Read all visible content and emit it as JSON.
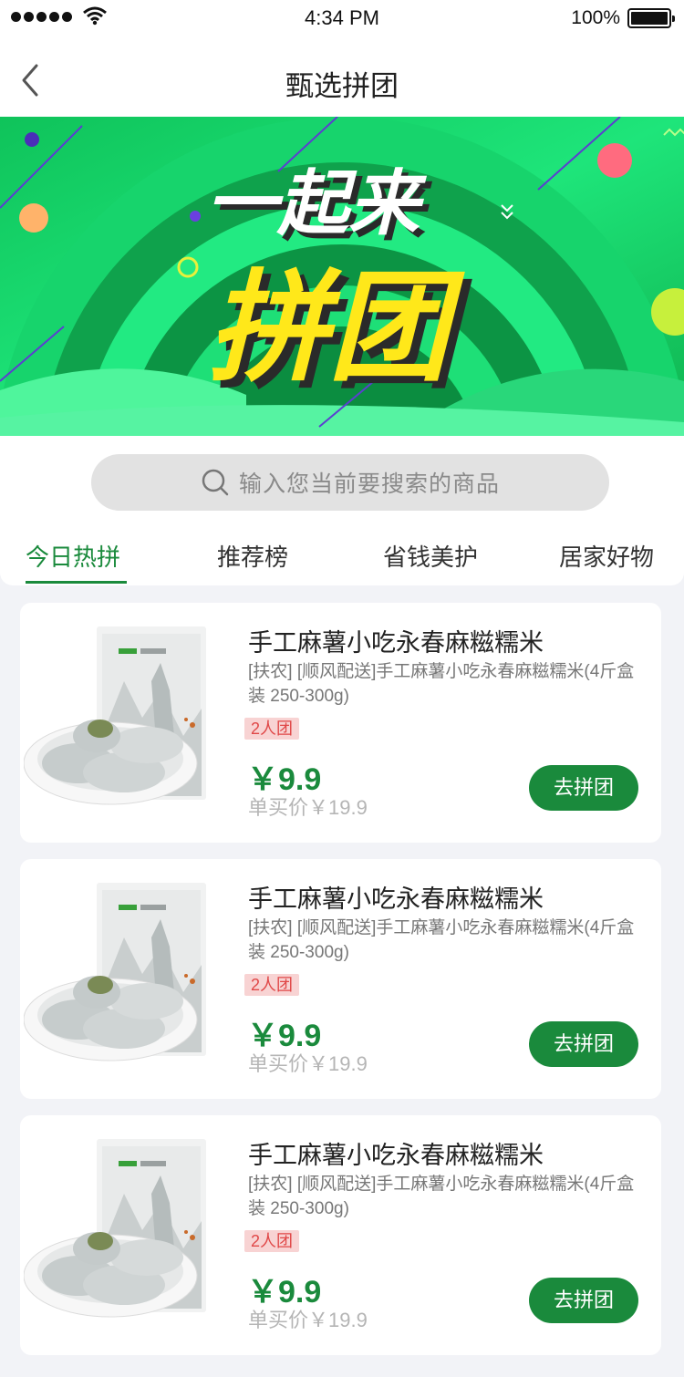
{
  "status_bar": {
    "time": "4:34 PM",
    "battery": "100%"
  },
  "nav": {
    "title": "甄选拼团"
  },
  "banner": {
    "line1": "一起来",
    "line2": "拼团"
  },
  "search": {
    "placeholder": "输入您当前要搜索的商品"
  },
  "tabs": [
    {
      "label": "今日热拼",
      "active": true
    },
    {
      "label": "推荐榜",
      "active": false
    },
    {
      "label": "省钱美护",
      "active": false
    },
    {
      "label": "居家好物",
      "active": false
    }
  ],
  "products": [
    {
      "title": "手工麻薯小吃永春麻糍糯米",
      "desc": "[扶农] [顺风配送]手工麻薯小吃永春麻糍糯米(4斤盒装 250-300g)",
      "tag": "2人团",
      "price": "￥9.9",
      "original_price": "单买价￥19.9",
      "button": "去拼团"
    },
    {
      "title": "手工麻薯小吃永春麻糍糯米",
      "desc": "[扶农] [顺风配送]手工麻薯小吃永春麻糍糯米(4斤盒装 250-300g)",
      "tag": "2人团",
      "price": "￥9.9",
      "original_price": "单买价￥19.9",
      "button": "去拼团"
    },
    {
      "title": "手工麻薯小吃永春麻糍糯米",
      "desc": "[扶农] [顺风配送]手工麻薯小吃永春麻糍糯米(4斤盒装 250-300g)",
      "tag": "2人团",
      "price": "￥9.9",
      "original_price": "单买价￥19.9",
      "button": "去拼团"
    }
  ],
  "colors": {
    "accent": "#1a8a3c",
    "tag_bg": "#f8d3d3",
    "tag_text": "#e04848",
    "banner_green": "#18d36a",
    "banner_yellow": "#ffe81a"
  }
}
